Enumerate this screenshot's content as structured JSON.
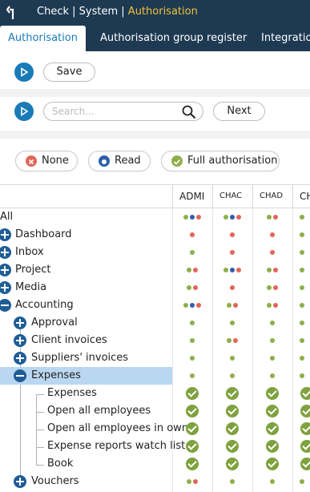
{
  "window": {
    "title_part1": "Check",
    "title_sep1": " | ",
    "title_part2": "System",
    "title_sep2": " | ",
    "title_active": "Authorisation"
  },
  "tabs": [
    {
      "label": "Authorisation",
      "active": true
    },
    {
      "label": "Authorisation group register",
      "active": false
    },
    {
      "label": "Integration",
      "active": false
    }
  ],
  "toolbar": {
    "save_label": "Save",
    "search_placeholder": "Search...",
    "search_value": "",
    "next_label": "Next"
  },
  "legend": [
    {
      "label": "None",
      "icon": "x-icon",
      "color": "#e0665a"
    },
    {
      "label": "Read",
      "icon": "dot-icon",
      "color": "#2e5fa8"
    },
    {
      "label": "Full authorisation",
      "icon": "check-icon",
      "color": "#8fae4a"
    }
  ],
  "columns": [
    "ADMI",
    "CHAC",
    "CHAD",
    "CH"
  ],
  "colors": {
    "none": "#e0665a",
    "read": "#2e5fa8",
    "full": "#8fae4a",
    "header_bg": "#1e3a52",
    "accent": "#1a7ab8",
    "title_highlight": "#f0c13a",
    "selection": "#b9d7f0"
  },
  "tree": [
    {
      "label": "All",
      "depth": 0,
      "expander": "none",
      "cells": [
        "fnr",
        "fnr",
        "fr",
        "f"
      ]
    },
    {
      "label": "Dashboard",
      "depth": 0,
      "expander": "plus",
      "cells": [
        "r",
        "r",
        "r",
        "f"
      ]
    },
    {
      "label": "Inbox",
      "depth": 0,
      "expander": "plus",
      "cells": [
        "f",
        "r",
        "r",
        "f"
      ]
    },
    {
      "label": "Project",
      "depth": 0,
      "expander": "plus",
      "cells": [
        "fr",
        "fnr",
        "fr",
        "f"
      ]
    },
    {
      "label": "Media",
      "depth": 0,
      "expander": "plus",
      "cells": [
        "fr",
        "r",
        "fr",
        "f"
      ]
    },
    {
      "label": "Accounting",
      "depth": 0,
      "expander": "minus",
      "cells": [
        "fnr",
        "fr",
        "fr",
        "f"
      ]
    },
    {
      "label": "Approval",
      "depth": 1,
      "expander": "plus",
      "cells": [
        "f",
        "f",
        "f",
        "f"
      ]
    },
    {
      "label": "Client invoices",
      "depth": 1,
      "expander": "plus",
      "cells": [
        "f",
        "fr",
        "f",
        "f"
      ]
    },
    {
      "label": "Suppliers' invoices",
      "depth": 1,
      "expander": "plus",
      "cells": [
        "f",
        "f",
        "f",
        "f"
      ]
    },
    {
      "label": "Expenses",
      "depth": 1,
      "expander": "minus",
      "selected": true,
      "cells": [
        "f",
        "f",
        "f",
        "f"
      ]
    },
    {
      "label": "Expenses",
      "depth": 2,
      "expander": "none",
      "cells": [
        "C",
        "C",
        "C",
        "C"
      ]
    },
    {
      "label": "Open all employees",
      "depth": 2,
      "expander": "none",
      "cells": [
        "C",
        "C",
        "C",
        "C"
      ]
    },
    {
      "label": "Open all employees in own",
      "depth": 2,
      "expander": "none",
      "cells": [
        "C",
        "C",
        "C",
        "C"
      ]
    },
    {
      "label": "Expense reports watch list",
      "depth": 2,
      "expander": "none",
      "cells": [
        "C",
        "C",
        "C",
        "C"
      ]
    },
    {
      "label": "Book",
      "depth": 2,
      "expander": "none",
      "cells": [
        "C",
        "C",
        "C",
        "C"
      ]
    },
    {
      "label": "Vouchers",
      "depth": 1,
      "expander": "plus",
      "cells": [
        "fr",
        "f",
        "f",
        "f"
      ]
    }
  ]
}
